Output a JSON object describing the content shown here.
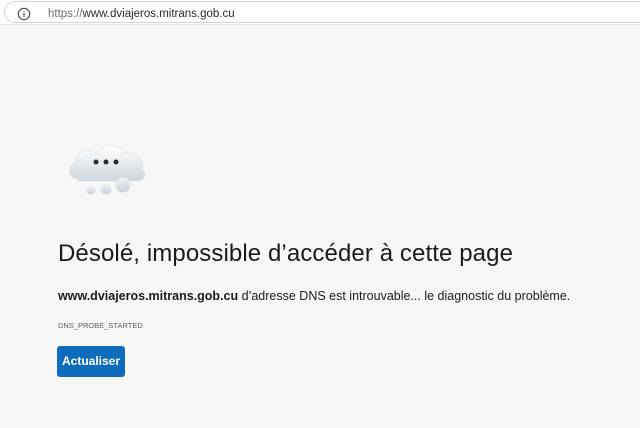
{
  "address_bar": {
    "icon": "info-circle-icon",
    "url_scheme": "https://",
    "url_host": "www.dviajeros.mitrans.gob.cu"
  },
  "error": {
    "icon": "cloud-with-dots-icon",
    "title": "Désolé, impossible d’accéder à cette page",
    "host": "www.dviajeros.mitrans.gob.cu",
    "message": " d’adresse DNS est introuvable... le diagnostic du problème.",
    "code": "DNS_PROBE_STARTED",
    "reload_label": "Actualiser"
  },
  "colors": {
    "accent": "#0f6cbd",
    "background": "#f7f7f7"
  }
}
